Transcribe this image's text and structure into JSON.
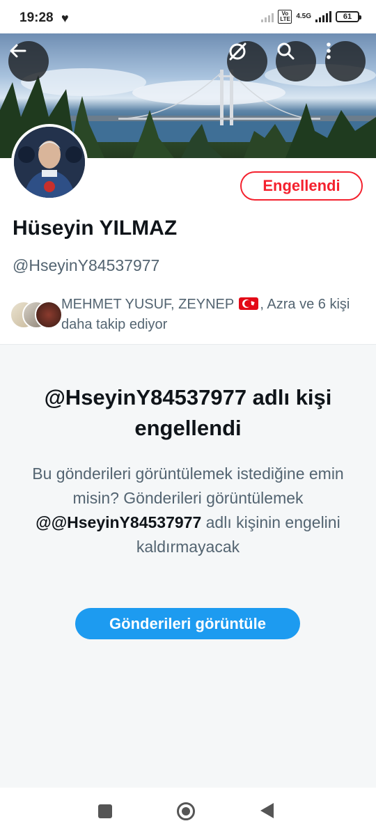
{
  "status_bar": {
    "time": "19:28",
    "volte": "Vo LTE",
    "network": "4.5G",
    "battery": "61"
  },
  "banner": {
    "icons": [
      "back-arrow-icon",
      "grok-icon",
      "search-icon",
      "more-icon"
    ]
  },
  "profile": {
    "block_button_label": "Engellendi",
    "name": "Hüseyin YILMAZ",
    "handle": "@HseyinY84537977",
    "followed_by_names": "MEHMET YUSUF, ZEYNEP",
    "followed_by_rest": ", Azra ve 6 kişi daha takip ediyor"
  },
  "blocked_panel": {
    "title": "@HseyinY84537977 adlı kişi engellendi",
    "desc_1": "Bu gönderileri görüntülemek istediğine emin misin? Gönderileri görüntülemek",
    "desc_handle": "@@HseyinY84537977",
    "desc_2": "adlı kişinin engelini kaldırmayacak",
    "view_button_label": "Gönderileri görüntüle"
  },
  "colors": {
    "accent": "#1d9bf0",
    "blocked_red": "#f4212e",
    "secondary_text": "#536471"
  }
}
